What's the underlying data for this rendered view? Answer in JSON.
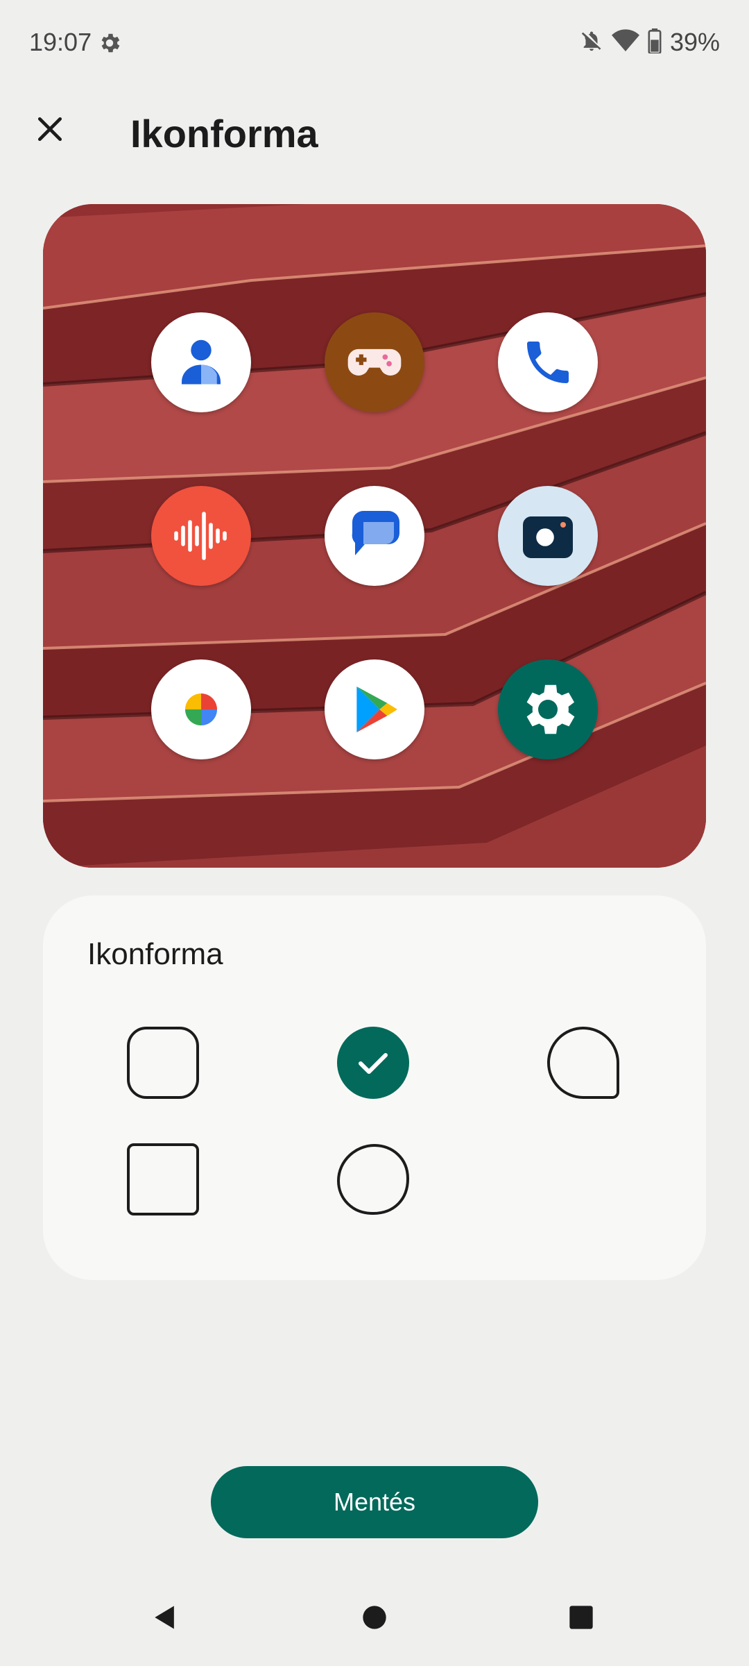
{
  "status_bar": {
    "time": "19:07",
    "battery_percent": "39%",
    "icons": [
      "settings-gear-icon",
      "notifications-off-icon",
      "wifi-icon",
      "battery-icon"
    ]
  },
  "header": {
    "title": "Ikonforma",
    "close_icon": "close-icon"
  },
  "preview": {
    "wallpaper": "red-roof-tiles",
    "apps": [
      {
        "name": "contacts",
        "icon": "contacts-icon",
        "bg": "#ffffff"
      },
      {
        "name": "games",
        "icon": "gamepad-icon",
        "bg": "#8c4a12"
      },
      {
        "name": "phone",
        "icon": "phone-icon",
        "bg": "#ffffff"
      },
      {
        "name": "recorder",
        "icon": "recorder-icon",
        "bg": "#f0523e"
      },
      {
        "name": "messages",
        "icon": "messages-icon",
        "bg": "#ffffff"
      },
      {
        "name": "camera",
        "icon": "camera-icon",
        "bg": "#d6e6f3"
      },
      {
        "name": "photos",
        "icon": "photos-pinwheel-icon",
        "bg": "#ffffff"
      },
      {
        "name": "play-store",
        "icon": "play-store-icon",
        "bg": "#ffffff"
      },
      {
        "name": "settings",
        "icon": "settings-icon",
        "bg": "#00695c"
      }
    ]
  },
  "shape_card": {
    "title": "Ikonforma",
    "options": [
      {
        "id": "rounded-square",
        "selected": false
      },
      {
        "id": "circle",
        "selected": true
      },
      {
        "id": "teardrop",
        "selected": false
      },
      {
        "id": "square",
        "selected": false
      },
      {
        "id": "pebble",
        "selected": false
      }
    ]
  },
  "save_button": {
    "label": "Mentés"
  },
  "nav": {
    "buttons": [
      "back-icon",
      "home-icon",
      "recents-icon"
    ]
  },
  "colors": {
    "accent": "#02695b",
    "background": "#eff0ee",
    "card": "#f8f9f6"
  }
}
